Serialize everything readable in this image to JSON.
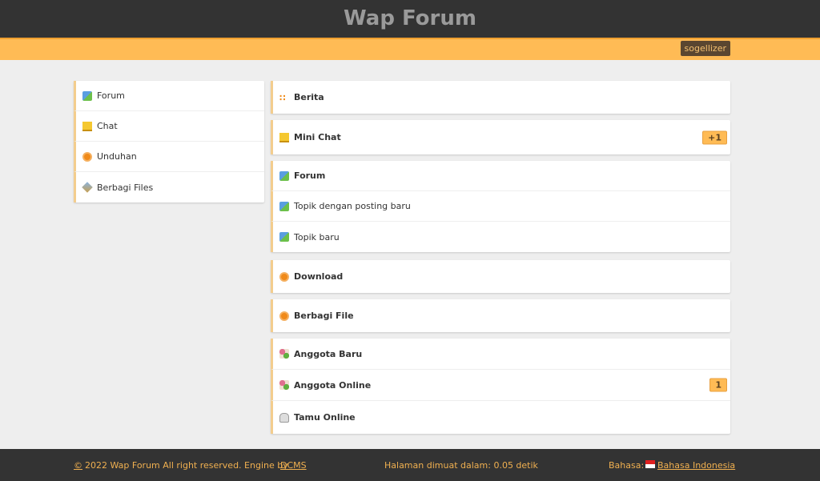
{
  "header": {
    "title": "Wap Forum"
  },
  "user": {
    "name": "sogellizer"
  },
  "sidebar": {
    "items": [
      {
        "label": "Forum",
        "icon": "forum-icon"
      },
      {
        "label": "Chat",
        "icon": "chat-icon"
      },
      {
        "label": "Unduhan",
        "icon": "download-icon"
      },
      {
        "label": "Berbagi Files",
        "icon": "share-icon"
      }
    ]
  },
  "main": {
    "berita": "Berita",
    "minichat": {
      "label": "Mini Chat",
      "badge": "+1"
    },
    "forum": {
      "label": "Forum",
      "items": [
        "Topik dengan posting baru",
        "Topik baru"
      ]
    },
    "download": "Download",
    "share": "Berbagi File",
    "members": {
      "new": "Anggota Baru",
      "online": "Anggota Online",
      "online_badge": "1",
      "guests": "Tamu Online"
    }
  },
  "footer": {
    "copyright_symbol": "©",
    "copyright": "2022 Wap Forum All right reserved. Engine by",
    "engine": "DCMS",
    "load": "Halaman dimuat dalam: 0.05 detik",
    "lang_label": "Bahasa:",
    "lang": "Bahasa Indonesia"
  },
  "colors": {
    "accent": "#ffbb55",
    "header": "#333333",
    "background": "#eeeeee"
  }
}
